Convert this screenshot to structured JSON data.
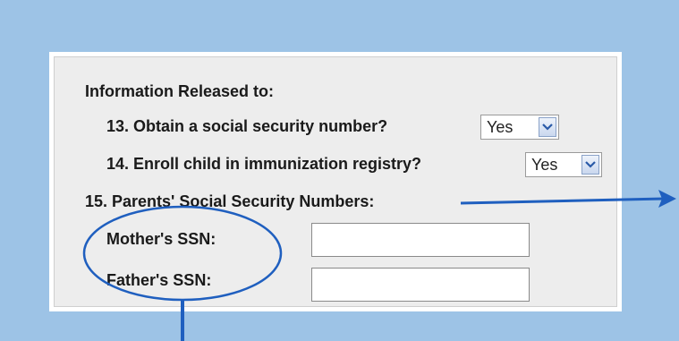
{
  "form": {
    "section_title": "Information Released to:",
    "q13": {
      "label": "13. Obtain a social security number?",
      "value": "Yes"
    },
    "q14": {
      "label": "14. Enroll child in immunization registry?",
      "value": "Yes"
    },
    "q15": {
      "label": "15. Parents' Social Security Numbers:"
    },
    "mother_ssn": {
      "label": "Mother's SSN:",
      "value": ""
    },
    "father_ssn": {
      "label": "Father's SSN:",
      "value": ""
    }
  },
  "icons": {
    "dropdown": "chevron-down-icon"
  },
  "colors": {
    "background": "#9dc3e6",
    "annotation": "#1f5fbf",
    "dropdown_arrow": "#2a5aa8"
  }
}
